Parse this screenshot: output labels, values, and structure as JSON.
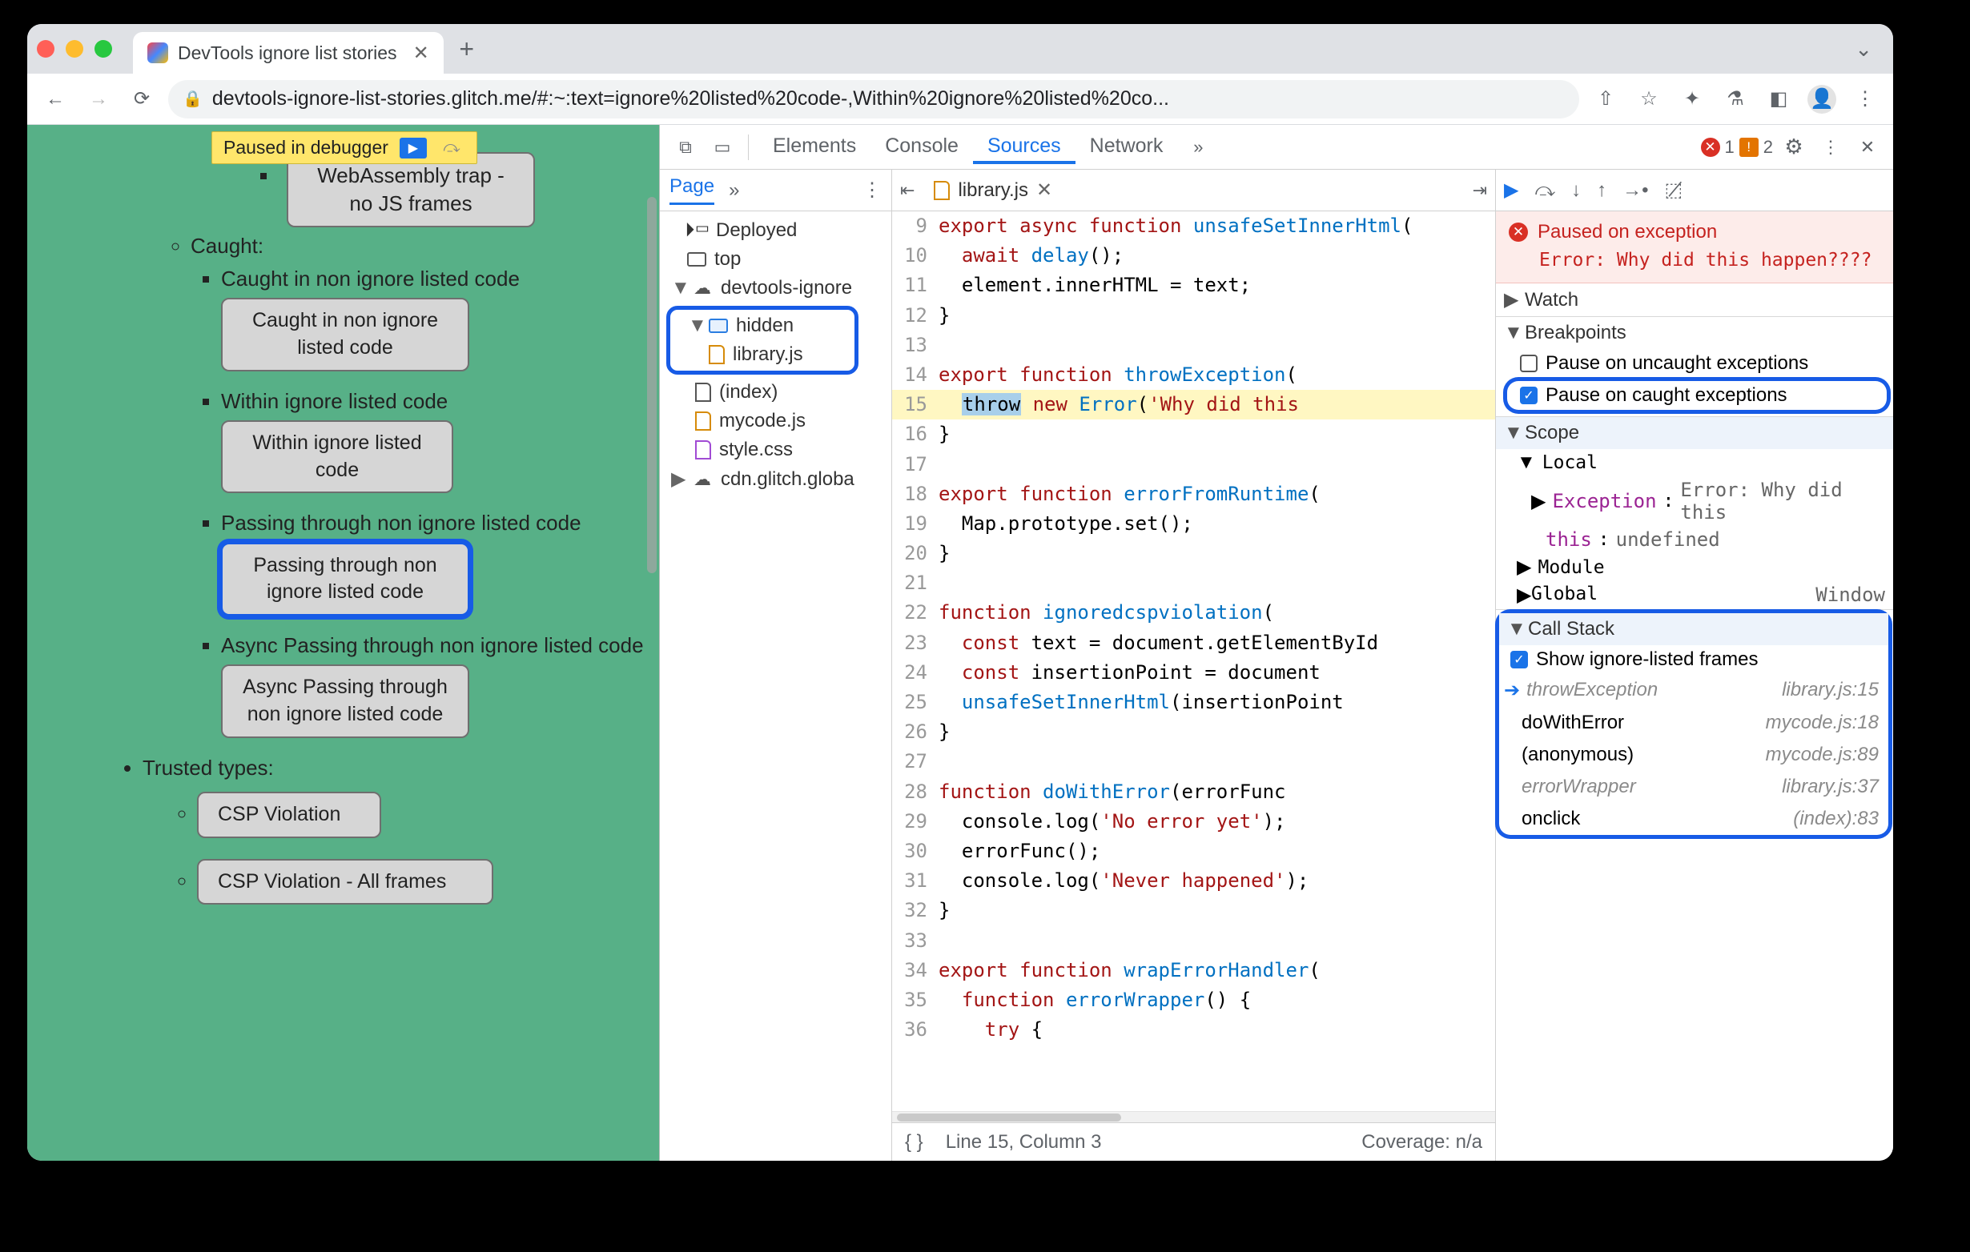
{
  "window": {
    "tab_title": "DevTools ignore list stories",
    "url": "devtools-ignore-list-stories.glitch.me/#:~:text=ignore%20listed%20code-,Within%20ignore%20listed%20co..."
  },
  "paused_pill": "Paused in debugger",
  "page_content": {
    "wasm_btn": "WebAssembly trap - no JS frames",
    "caught_label": "Caught:",
    "li1": "Caught in non ignore listed code",
    "btn1": "Caught in non ignore listed code",
    "li2": "Within ignore listed code",
    "btn2": "Within ignore listed code",
    "li3": "Passing through non ignore listed code",
    "btn3": "Passing through non ignore listed code",
    "li4": "Async Passing through non ignore listed code",
    "btn4": "Async Passing through non ignore listed code",
    "trusted": "Trusted types:",
    "btn5": "CSP Violation",
    "btn6": "CSP Violation - All frames"
  },
  "devtools": {
    "panels": [
      "Elements",
      "Console",
      "Sources",
      "Network"
    ],
    "active_panel": "Sources",
    "error_count": "1",
    "warn_count": "2",
    "nav": {
      "tab": "Page",
      "deployed": "Deployed",
      "top": "top",
      "domain": "devtools-ignore",
      "folder": "hidden",
      "file_in_folder": "library.js",
      "index": "(index)",
      "mycode": "mycode.js",
      "style": "style.css",
      "cdn": "cdn.glitch.globa"
    },
    "code": {
      "filename": "library.js",
      "lines": [
        {
          "n": 9,
          "t": "export async function unsafeSetInnerHtml("
        },
        {
          "n": 10,
          "t": "  await delay();"
        },
        {
          "n": 11,
          "t": "  element.innerHTML = text;"
        },
        {
          "n": 12,
          "t": "}"
        },
        {
          "n": 13,
          "t": ""
        },
        {
          "n": 14,
          "t": "export function throwException("
        },
        {
          "n": 15,
          "t": "  throw new Error('Why did this",
          "hl": true,
          "selword": "throw"
        },
        {
          "n": 16,
          "t": "}"
        },
        {
          "n": 17,
          "t": ""
        },
        {
          "n": 18,
          "t": "export function errorFromRuntime("
        },
        {
          "n": 19,
          "t": "  Map.prototype.set();"
        },
        {
          "n": 20,
          "t": "}"
        },
        {
          "n": 21,
          "t": ""
        },
        {
          "n": 22,
          "t": "function ignoredcspviolation("
        },
        {
          "n": 23,
          "t": "  const text = document.getElementById"
        },
        {
          "n": 24,
          "t": "  const insertionPoint = document"
        },
        {
          "n": 25,
          "t": "  unsafeSetInnerHtml(insertionPoint"
        },
        {
          "n": 26,
          "t": "}"
        },
        {
          "n": 27,
          "t": ""
        },
        {
          "n": 28,
          "t": "function doWithError(errorFunc"
        },
        {
          "n": 29,
          "t": "  console.log('No error yet');"
        },
        {
          "n": 30,
          "t": "  errorFunc();"
        },
        {
          "n": 31,
          "t": "  console.log('Never happened');"
        },
        {
          "n": 32,
          "t": "}"
        },
        {
          "n": 33,
          "t": ""
        },
        {
          "n": 34,
          "t": "export function wrapErrorHandler("
        },
        {
          "n": 35,
          "t": "  function errorWrapper() {"
        },
        {
          "n": 36,
          "t": "    try {"
        }
      ],
      "status_line": "Line 15, Column 3",
      "coverage": "Coverage: n/a"
    },
    "exception": {
      "title": "Paused on exception",
      "msg": "Error: Why did this happen????"
    },
    "watch": "Watch",
    "breakpoints": {
      "title": "Breakpoints",
      "uncaught": "Pause on uncaught exceptions",
      "caught": "Pause on caught exceptions"
    },
    "scope": {
      "title": "Scope",
      "local": "Local",
      "exception_k": "Exception",
      "exception_v": "Error: Why did this",
      "this_k": "this",
      "this_v": "undefined",
      "module": "Module",
      "global": "Global",
      "global_v": "Window"
    },
    "callstack": {
      "title": "Call Stack",
      "show_ignored": "Show ignore-listed frames",
      "frames": [
        {
          "fn": "throwException",
          "loc": "library.js:15",
          "ig": true,
          "cur": true
        },
        {
          "fn": "doWithError",
          "loc": "mycode.js:18"
        },
        {
          "fn": "(anonymous)",
          "loc": "mycode.js:89"
        },
        {
          "fn": "errorWrapper",
          "loc": "library.js:37",
          "ig": true
        },
        {
          "fn": "onclick",
          "loc": "(index):83"
        }
      ]
    }
  }
}
